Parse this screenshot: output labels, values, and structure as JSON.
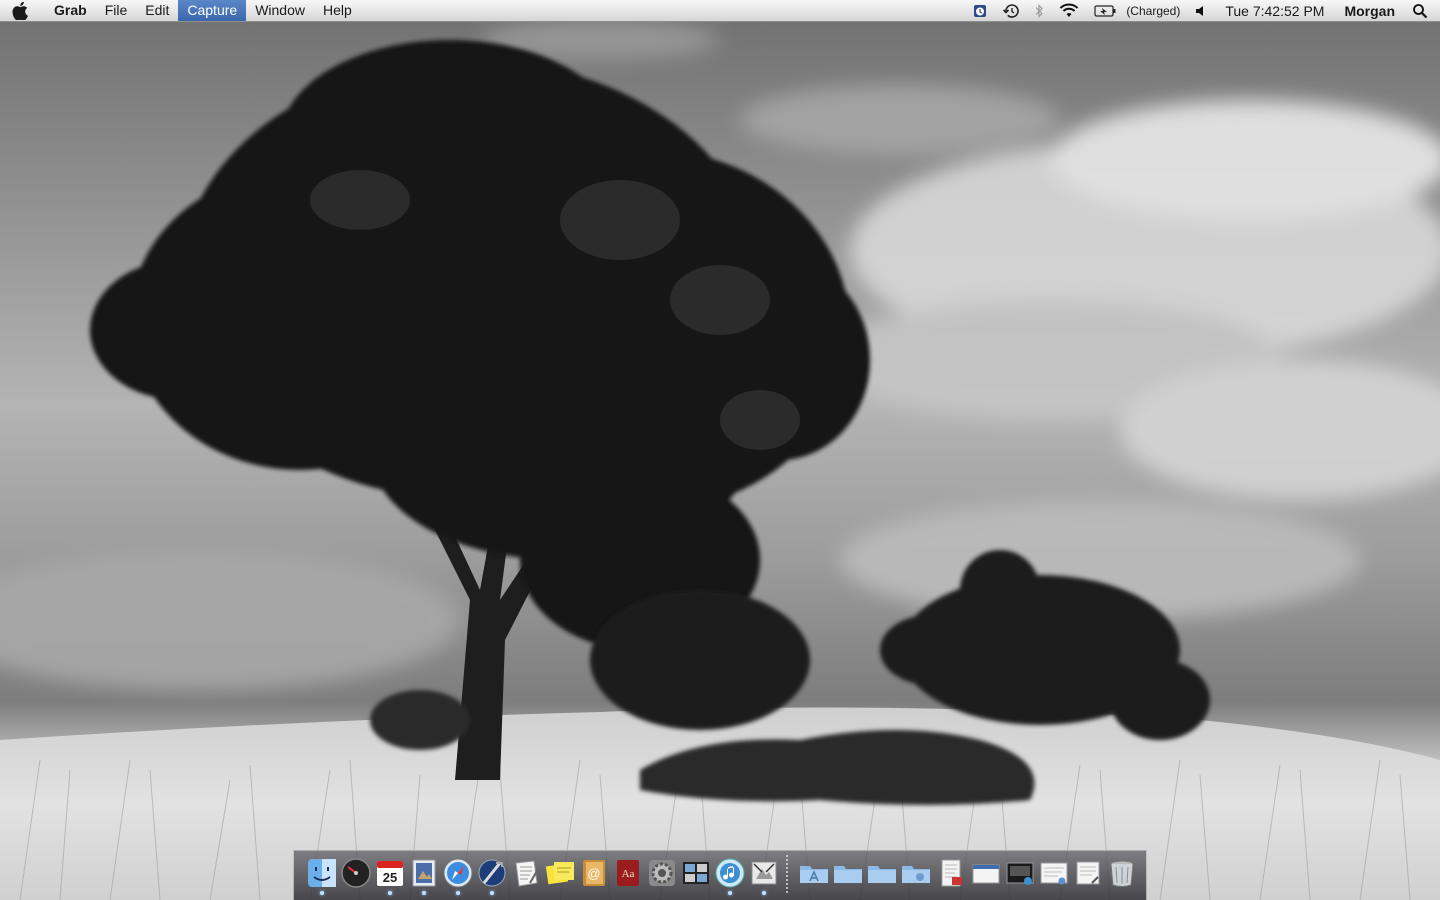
{
  "menubar": {
    "app_name": "Grab",
    "menus": [
      "File",
      "Edit",
      "Capture",
      "Window",
      "Help"
    ],
    "active_menu": "Capture",
    "battery_status": "(Charged)",
    "clock": "Tue 7:42:52 PM",
    "user": "Morgan",
    "status_icons": [
      "alarm-clock-icon",
      "time-machine-icon",
      "bluetooth-icon",
      "wifi-icon",
      "battery-icon",
      "volume-icon",
      "spotlight-icon"
    ]
  },
  "dock": {
    "apps": [
      {
        "name": "finder",
        "running": true
      },
      {
        "name": "dashboard",
        "running": false
      },
      {
        "name": "ical",
        "running": true,
        "date": "25"
      },
      {
        "name": "preview",
        "running": true
      },
      {
        "name": "safari",
        "running": true
      },
      {
        "name": "xcode",
        "running": true
      },
      {
        "name": "textedit",
        "running": false
      },
      {
        "name": "stickies",
        "running": false
      },
      {
        "name": "address-book",
        "running": false
      },
      {
        "name": "dictionary",
        "running": false
      },
      {
        "name": "system-preferences",
        "running": false
      },
      {
        "name": "expose-spaces",
        "running": false
      },
      {
        "name": "itunes",
        "running": true
      },
      {
        "name": "grab",
        "running": true
      }
    ],
    "folders": [
      "applications-folder",
      "documents-folder",
      "downloads-folder",
      "home-folder"
    ],
    "documents": [
      "doc-stack-1",
      "doc-stack-2",
      "doc-stack-3",
      "doc-stack-4",
      "doc-stack-5"
    ],
    "trash": "trash-icon"
  },
  "colors": {
    "menu_highlight": "#3b67ad",
    "run_indicator": "#bfe3ff"
  }
}
